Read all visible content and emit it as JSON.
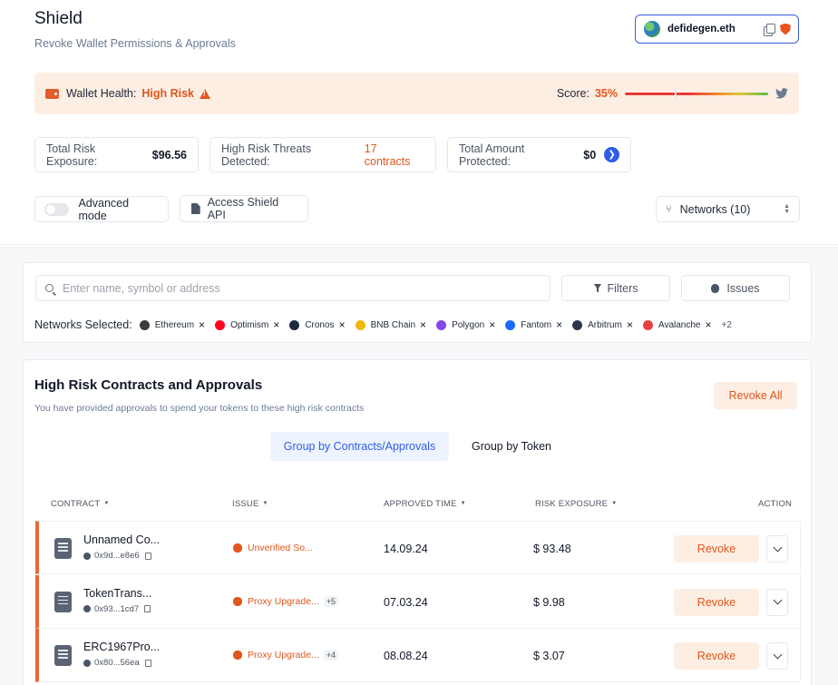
{
  "header": {
    "title": "Shield",
    "subtitle": "Revoke Wallet Permissions & Approvals",
    "wallet_name": "defidegen.eth"
  },
  "health": {
    "label": "Wallet Health:",
    "value": "High Risk",
    "score_label": "Score:",
    "score_value": "35%",
    "score_fraction": 0.35
  },
  "stats": {
    "exposure_label": "Total Risk Exposure:",
    "exposure_value": "$96.56",
    "threats_label": "High Risk Threats Detected:",
    "threats_value": "17 contracts",
    "protected_label": "Total Amount Protected:",
    "protected_value": "$0"
  },
  "controls": {
    "advanced_mode": "Advanced mode",
    "api_label": "Access Shield API",
    "networks_label": "Networks (10)"
  },
  "search": {
    "placeholder": "Enter name, symbol or address",
    "filters_label": "Filters",
    "issues_label": "Issues",
    "networks_selected_label": "Networks Selected:",
    "more_label": "+2",
    "networks": [
      {
        "name": "Ethereum",
        "color": "#3c3c3d"
      },
      {
        "name": "Optimism",
        "color": "#ff0420"
      },
      {
        "name": "Cronos",
        "color": "#1d2b3c"
      },
      {
        "name": "BNB Chain",
        "color": "#f0b90b"
      },
      {
        "name": "Polygon",
        "color": "#8247e5"
      },
      {
        "name": "Fantom",
        "color": "#1969ff"
      },
      {
        "name": "Arbitrum",
        "color": "#2d374b"
      },
      {
        "name": "Avalanche",
        "color": "#e84142"
      }
    ]
  },
  "table": {
    "title": "High Risk Contracts and Approvals",
    "subtitle": "You have provided approvals to spend your tokens to these high risk contracts",
    "revoke_all": "Revoke All",
    "group_contracts": "Group by Contracts/Approvals",
    "group_token": "Group by Token",
    "columns": {
      "contract": "CONTRACT",
      "issue": "ISSUE",
      "approved_time": "APPROVED TIME",
      "risk_exposure": "RISK EXPOSURE",
      "action": "ACTION"
    },
    "revoke_label": "Revoke",
    "rows": [
      {
        "name": "Unnamed Co...",
        "address": "0x9d...e8e6",
        "issue": "Unverified So...",
        "extra": "",
        "time": "14.09.24",
        "risk": "$ 93.48"
      },
      {
        "name": "TokenTrans...",
        "address": "0x93...1cd7",
        "issue": "Proxy Upgrade...",
        "extra": "+5",
        "time": "07.03.24",
        "risk": "$ 9.98"
      },
      {
        "name": "ERC1967Pro...",
        "address": "0x80...56ea",
        "issue": "Proxy Upgrade...",
        "extra": "+4",
        "time": "08.08.24",
        "risk": "$ 3.07"
      }
    ]
  }
}
